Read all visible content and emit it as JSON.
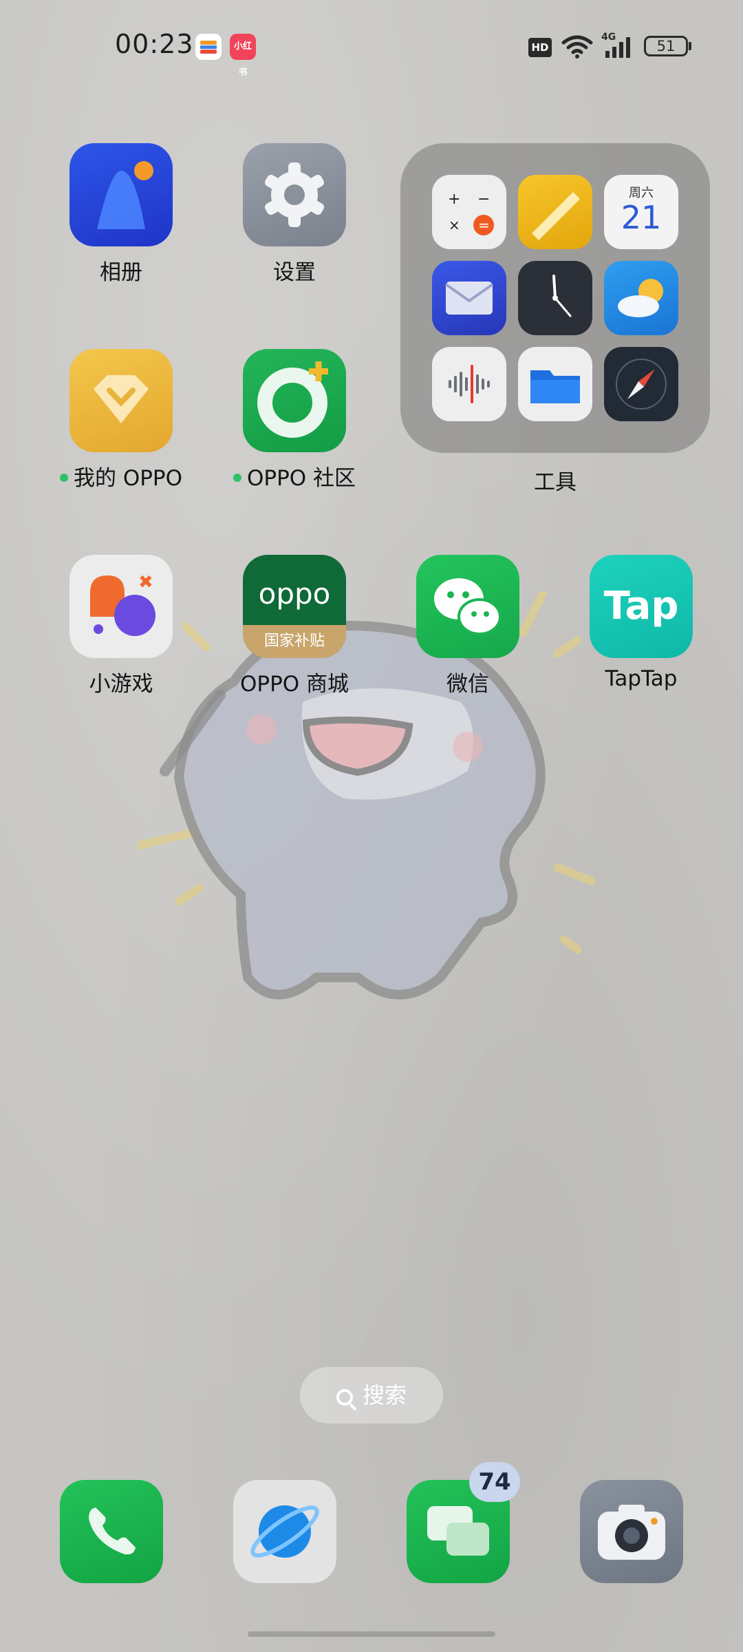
{
  "status_bar": {
    "time": "00:23",
    "notifications": [
      "wallet-icon",
      "xiaohongshu-icon"
    ],
    "xiaohongshu_text": "小红书",
    "hd": "HD",
    "network": "4G",
    "battery": "51"
  },
  "apps": [
    {
      "id": "photos",
      "label": "相册",
      "icon": "photos-icon"
    },
    {
      "id": "settings",
      "label": "设置",
      "icon": "gear-icon"
    },
    {
      "id": "my-oppo",
      "label": "我的 OPPO",
      "icon": "diamond-icon",
      "dot": true
    },
    {
      "id": "oppo-community",
      "label": "OPPO 社区",
      "icon": "community-icon",
      "dot": true
    },
    {
      "id": "mini-games",
      "label": "小游戏",
      "icon": "game-icon"
    },
    {
      "id": "oppo-store",
      "label": "OPPO 商城",
      "icon": "oppo-store-icon",
      "icon_text": "oppo",
      "icon_sub": "国家补贴"
    },
    {
      "id": "wechat",
      "label": "微信",
      "icon": "wechat-icon"
    },
    {
      "id": "taptap",
      "label": "TapTap",
      "icon": "taptap-icon",
      "icon_text": "Tap"
    }
  ],
  "folder": {
    "label": "工具",
    "items": [
      "calculator-icon",
      "notes-icon",
      "calendar-icon",
      "mail-icon",
      "clock-icon",
      "weather-icon",
      "recorder-icon",
      "files-icon",
      "compass-icon"
    ],
    "calendar_day": "周六",
    "calendar_date": "21"
  },
  "search": {
    "label": "搜索"
  },
  "dock": {
    "items": [
      "phone-icon",
      "browser-icon",
      "messages-icon",
      "camera-icon"
    ],
    "messages_badge": "74"
  },
  "colors": {
    "wallpaper": "#c6c5c2",
    "accent_green": "#2ec267"
  }
}
